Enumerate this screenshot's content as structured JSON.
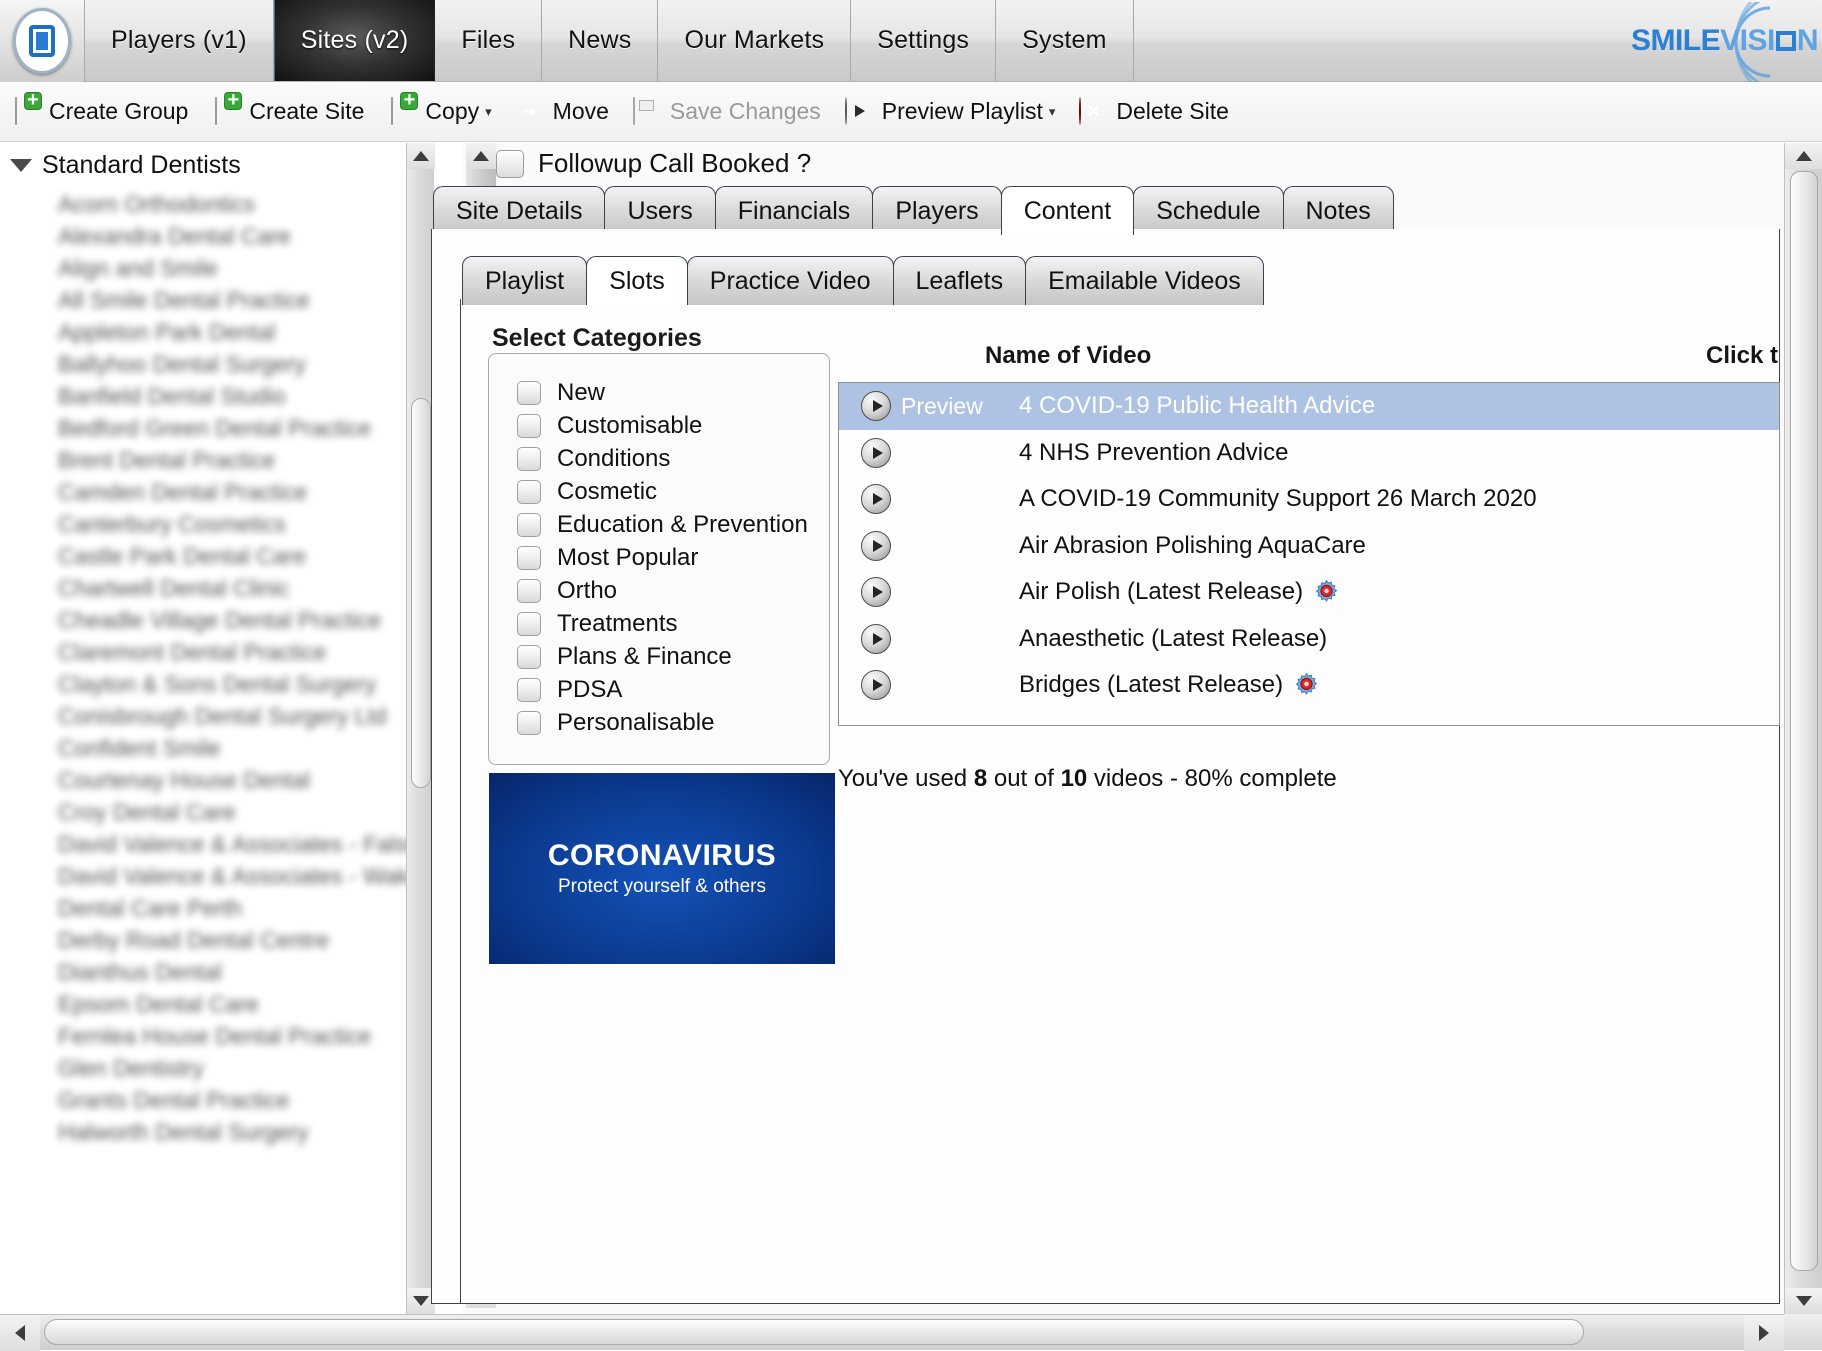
{
  "topnav": {
    "logo_name": "smilevision-logo",
    "tabs": [
      {
        "label": "Players (v1)",
        "active": false
      },
      {
        "label": "Sites (v2)",
        "active": true
      },
      {
        "label": "Files",
        "active": false
      },
      {
        "label": "News",
        "active": false
      },
      {
        "label": "Our Markets",
        "active": false
      },
      {
        "label": "Settings",
        "active": false
      },
      {
        "label": "System",
        "active": false
      }
    ],
    "brand_part1": "SMILE",
    "brand_part2": "VISI",
    "brand_part3": "N"
  },
  "toolbar": {
    "items": [
      {
        "label": "Create Group",
        "icon": "new-document-icon",
        "disabled": false,
        "caret": false
      },
      {
        "label": "Create Site",
        "icon": "new-document-icon",
        "disabled": false,
        "caret": false
      },
      {
        "label": "Copy",
        "icon": "new-document-icon",
        "disabled": false,
        "caret": true
      },
      {
        "label": "Move",
        "icon": "move-arrow-icon",
        "disabled": false,
        "caret": false
      },
      {
        "label": "Save Changes",
        "icon": "save-disk-icon",
        "disabled": true,
        "caret": false
      },
      {
        "label": "Preview Playlist",
        "icon": "play-circle-icon",
        "disabled": false,
        "caret": true
      },
      {
        "label": "Delete Site",
        "icon": "delete-x-icon",
        "disabled": false,
        "caret": false
      }
    ]
  },
  "sidebar": {
    "root_label": "Standard Dentists",
    "items": [
      "Acorn Orthodontics",
      "Alexandra Dental Care",
      "Align and Smile",
      "All Smile Dental Practice",
      "Appleton Park Dental",
      "Ballyhoo Dental Surgery",
      "Banfield Dental Studio",
      "Bedford Green Dental Practice",
      "Brent Dental Practice",
      "Camden Dental Practice",
      "Canterbury Cosmetics",
      "Castle Park Dental Care",
      "Chartwell Dental Clinic",
      "Cheadle Village Dental Practice",
      "Claremont Dental Practice",
      "Clayton & Sons Dental Surgery",
      "Conisbrough Dental Surgery Ltd",
      "Confident Smile",
      "Courtenay House Dental",
      "Croy Dental Care",
      "David Valence & Associates - Falsworth",
      "David Valence & Associates - Wakefield",
      "Dental Care Perth",
      "Derby Road Dental Centre",
      "Dianthus Dental",
      "Epsom Dental Care",
      "Fernlea House Dental Practice",
      "Glen Dentistry",
      "Grants Dental Practice",
      "Halworth Dental Surgery"
    ]
  },
  "detail": {
    "header_checkbox_label": "Followup Call Booked ?",
    "outer_tabs": [
      {
        "label": "Site Details",
        "active": false
      },
      {
        "label": "Users",
        "active": false
      },
      {
        "label": "Financials",
        "active": false
      },
      {
        "label": "Players",
        "active": false
      },
      {
        "label": "Content",
        "active": true
      },
      {
        "label": "Schedule",
        "active": false
      },
      {
        "label": "Notes",
        "active": false
      }
    ],
    "inner_tabs": [
      {
        "label": "Playlist",
        "active": false
      },
      {
        "label": "Slots",
        "active": true
      },
      {
        "label": "Practice Video",
        "active": false
      },
      {
        "label": "Leaflets",
        "active": false
      },
      {
        "label": "Emailable Videos",
        "active": false
      }
    ]
  },
  "categories": {
    "title": "Select Categories",
    "items": [
      {
        "label": "New",
        "checked": false
      },
      {
        "label": "Customisable",
        "checked": false
      },
      {
        "label": "Conditions",
        "checked": false
      },
      {
        "label": "Cosmetic",
        "checked": false
      },
      {
        "label": "Education & Prevention",
        "checked": false
      },
      {
        "label": "Most Popular",
        "checked": false
      },
      {
        "label": "Ortho",
        "checked": false
      },
      {
        "label": "Treatments",
        "checked": false
      },
      {
        "label": "Plans & Finance",
        "checked": false
      },
      {
        "label": "PDSA",
        "checked": false
      },
      {
        "label": "Personalisable",
        "checked": false
      }
    ]
  },
  "thumbnail": {
    "title": "CORONAVIRUS",
    "subtitle": "Protect yourself & others"
  },
  "videos": {
    "col_name": "Name of Video",
    "col_click": "Click t",
    "preview_label": "Preview",
    "rows": [
      {
        "name": "4 COVID-19 Public Health Advice",
        "selected": true,
        "gear": false
      },
      {
        "name": "4 NHS Prevention Advice",
        "selected": false,
        "gear": false
      },
      {
        "name": "A COVID-19 Community Support 26 March 2020",
        "selected": false,
        "gear": false
      },
      {
        "name": "Air Abrasion Polishing AquaCare",
        "selected": false,
        "gear": false
      },
      {
        "name": "Air Polish (Latest Release)",
        "selected": false,
        "gear": true
      },
      {
        "name": "Anaesthetic (Latest Release)",
        "selected": false,
        "gear": false
      },
      {
        "name": "Bridges (Latest Release)",
        "selected": false,
        "gear": true
      }
    ],
    "usage_prefix": "You've used ",
    "usage_used": "8",
    "usage_mid": " out of ",
    "usage_total": "10",
    "usage_suffix": " videos - 80% complete"
  },
  "colors": {
    "accent": "#2b7fd4",
    "selection": "#aec3e4",
    "tab_border": "#39424e",
    "thumb_blue": "#0c3c93"
  }
}
